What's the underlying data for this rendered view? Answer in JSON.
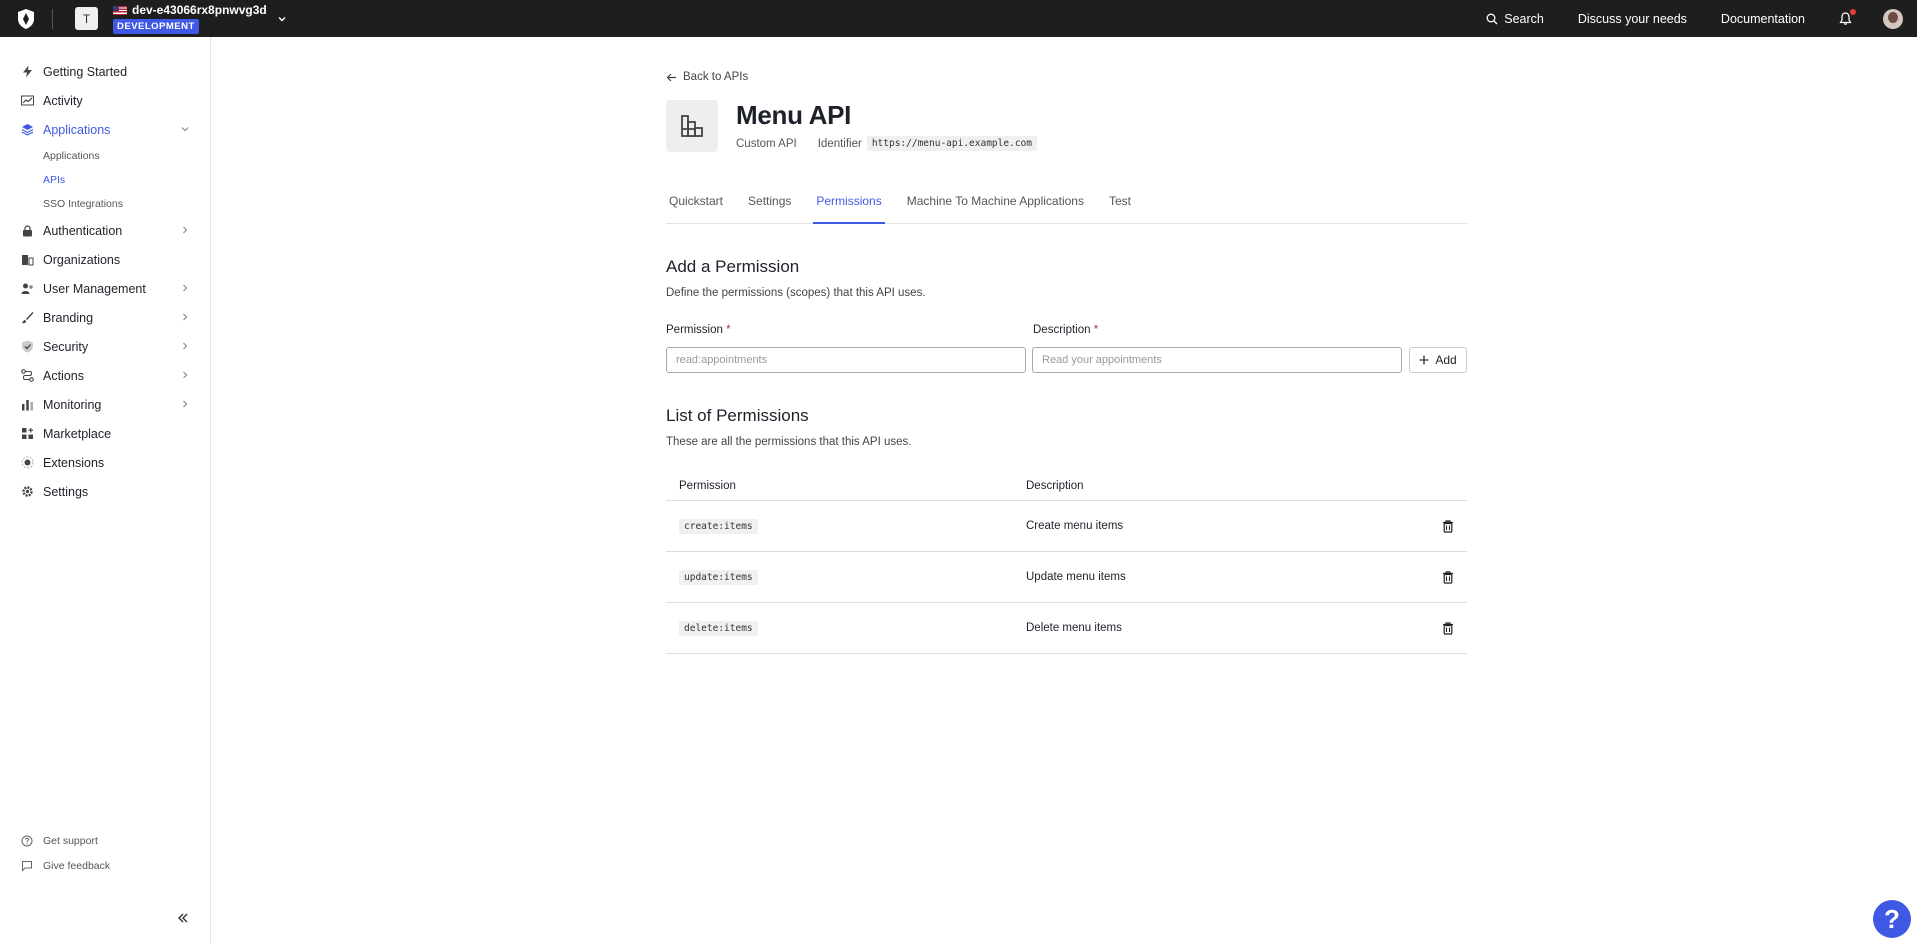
{
  "topbar": {
    "tenant_initial": "T",
    "tenant_name": "dev-e43066rx8pnwvg3d",
    "environment": "DEVELOPMENT",
    "search_label": "Search",
    "discuss_label": "Discuss your needs",
    "docs_label": "Documentation"
  },
  "sidebar": {
    "items": [
      {
        "label": "Getting Started",
        "icon": "bolt-icon"
      },
      {
        "label": "Activity",
        "icon": "chart-line-icon"
      },
      {
        "label": "Applications",
        "icon": "layers-icon"
      },
      {
        "label": "Authentication",
        "icon": "lock-icon"
      },
      {
        "label": "Organizations",
        "icon": "building-icon"
      },
      {
        "label": "User Management",
        "icon": "users-icon"
      },
      {
        "label": "Branding",
        "icon": "brush-icon"
      },
      {
        "label": "Security",
        "icon": "shield-icon"
      },
      {
        "label": "Actions",
        "icon": "flow-icon"
      },
      {
        "label": "Monitoring",
        "icon": "bar-chart-icon"
      },
      {
        "label": "Marketplace",
        "icon": "grid-plus-icon"
      },
      {
        "label": "Extensions",
        "icon": "extension-icon"
      },
      {
        "label": "Settings",
        "icon": "gear-icon"
      }
    ],
    "sub_items": [
      "Applications",
      "APIs",
      "SSO Integrations"
    ],
    "support_label": "Get support",
    "feedback_label": "Give feedback"
  },
  "main": {
    "back_label": "Back to APIs",
    "api_name": "Menu API",
    "api_type": "Custom API",
    "identifier_label": "Identifier",
    "identifier_value": "https://menu-api.example.com",
    "tabs": [
      "Quickstart",
      "Settings",
      "Permissions",
      "Machine To Machine Applications",
      "Test"
    ],
    "active_tab": "Permissions",
    "add_section": {
      "title": "Add a Permission",
      "description": "Define the permissions (scopes) that this API uses.",
      "permission_label": "Permission",
      "description_label": "Description",
      "required_mark": "*",
      "permission_placeholder": "read:appointments",
      "description_placeholder": "Read your appointments",
      "add_label": "Add"
    },
    "list_section": {
      "title": "List of Permissions",
      "description": "These are all the permissions that this API uses.",
      "columns": [
        "Permission",
        "Description"
      ],
      "rows": [
        {
          "permission": "create:items",
          "description": "Create menu items"
        },
        {
          "permission": "update:items",
          "description": "Update menu items"
        },
        {
          "permission": "delete:items",
          "description": "Delete menu items"
        }
      ]
    }
  },
  "help_label": "?",
  "colors": {
    "accent": "#3f59e4",
    "topbar": "#1e1e1e"
  }
}
